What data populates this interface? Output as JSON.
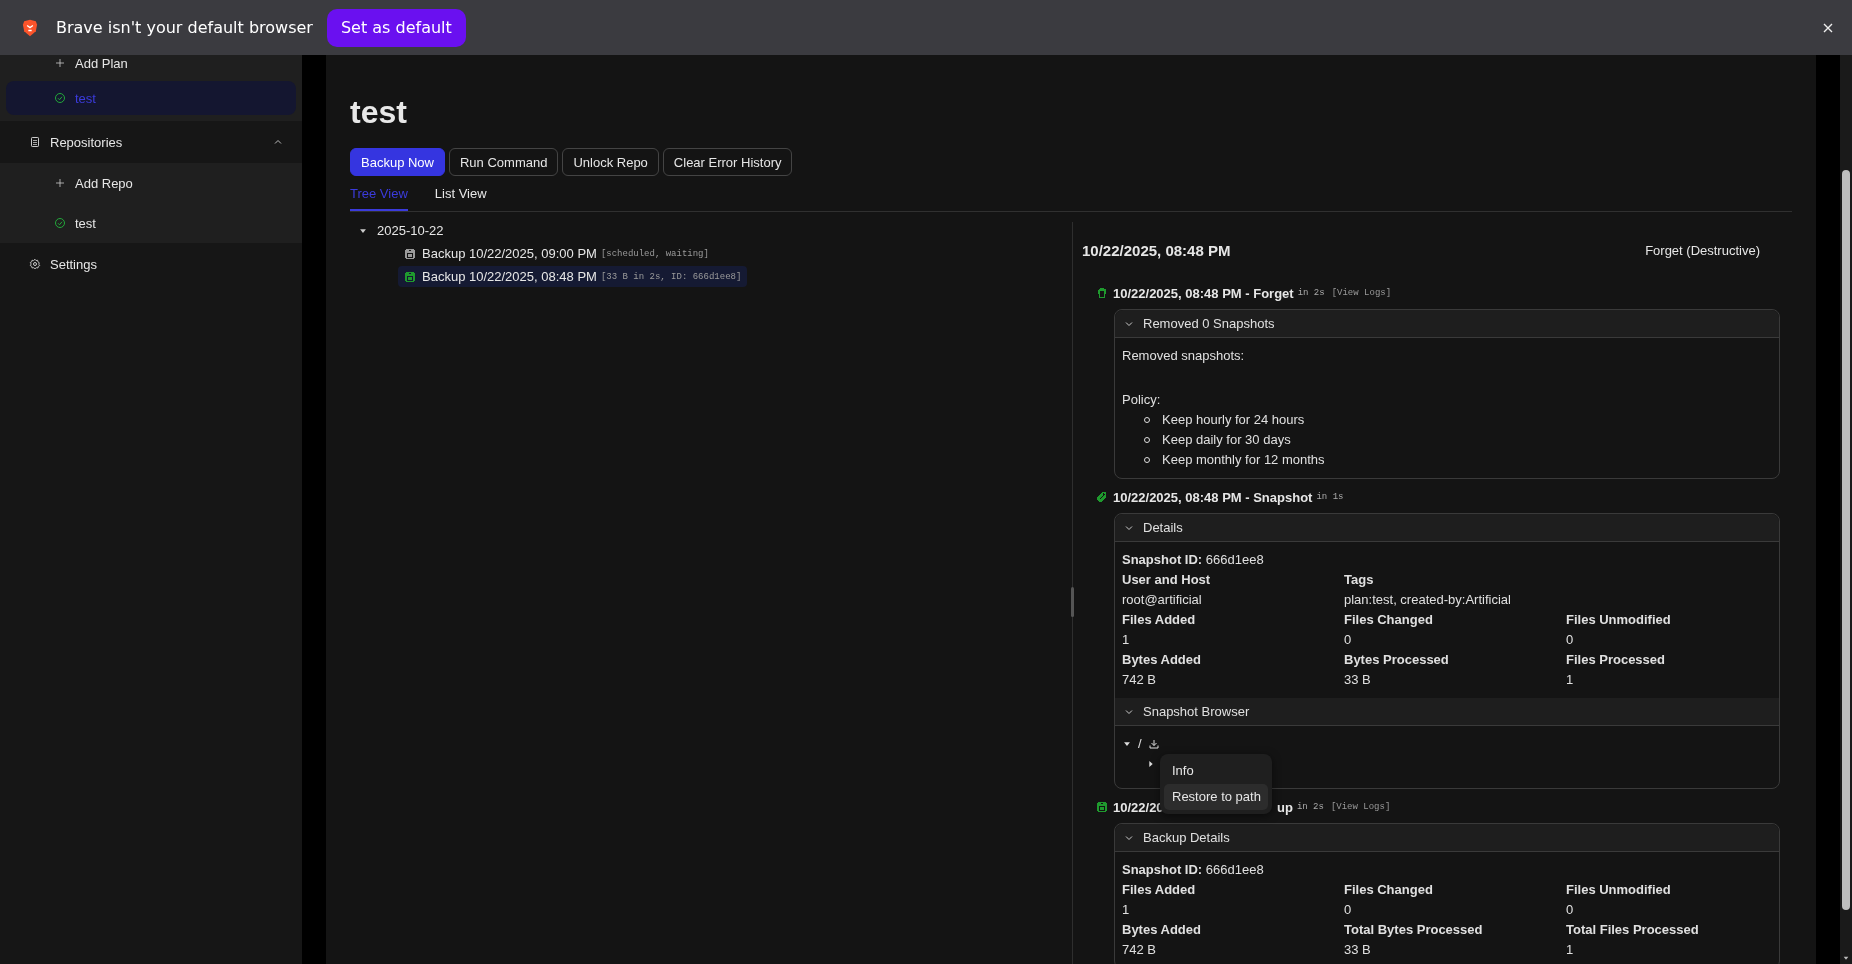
{
  "infobar": {
    "message": "Brave isn't your default browser",
    "button": "Set as default"
  },
  "sidebar": {
    "items": [
      {
        "kind": "action",
        "label": "Add Plan",
        "selected": false
      },
      {
        "kind": "plan",
        "label": "test",
        "selected": true
      },
      {
        "kind": "group",
        "label": "Repositories",
        "expanded": true,
        "children": [
          {
            "kind": "action",
            "label": "Add Repo",
            "selected": false
          },
          {
            "kind": "repo",
            "label": "test",
            "selected": false
          }
        ]
      },
      {
        "kind": "settings",
        "label": "Settings",
        "selected": false
      }
    ]
  },
  "plan": {
    "title": "test",
    "buttons": [
      {
        "label": "Backup Now",
        "kind": "primary"
      },
      {
        "label": "Run Command",
        "kind": "secondary"
      },
      {
        "label": "Unlock Repo",
        "kind": "secondary"
      },
      {
        "label": "Clear Error History",
        "kind": "secondary"
      }
    ],
    "tabs": [
      {
        "label": "Tree View",
        "selected": true
      },
      {
        "label": "List View",
        "selected": false
      }
    ],
    "tree": [
      {
        "label": "2025-10-22",
        "expanded": true,
        "children": [
          {
            "label": "Backup 10/22/2025, 09:00 PM",
            "meta": "[scheduled, waiting]",
            "color": "#9a9a9a",
            "selected": false
          },
          {
            "label": "Backup 10/22/2025, 08:48 PM",
            "meta": "[33 B in 2s, ID: 666d1ee8]",
            "color": "#1f9a2e",
            "selected": true
          }
        ]
      }
    ]
  },
  "detail": {
    "title": "10/22/2025, 08:48 PM",
    "action_button": "Forget (Destructive)",
    "operations": [
      {
        "kind": "forget",
        "color": "#1f9a2e",
        "title_parts": [
          "10/22/2025, 08:48 PM - Forget"
        ],
        "duration": "in 2s",
        "logs_link": "[View Logs]",
        "sections": [
          {
            "kind": "forget_result",
            "title": "Removed 0 Snapshots",
            "expanded": true,
            "removed_label": "Removed snapshots:",
            "policy_label": "Policy:",
            "policy": [
              "Keep hourly for 24 hours",
              "Keep daily for 30 days",
              "Keep monthly for 12 months"
            ]
          }
        ]
      },
      {
        "kind": "snapshot",
        "color": "#1f9a2e",
        "title_parts": [
          "10/22/2025, 08:48 PM - Snapshot"
        ],
        "duration": "in 1s",
        "sections": [
          {
            "kind": "details",
            "title": "Details",
            "expanded": true,
            "snapshot_id_label": "Snapshot ID:",
            "snapshot_id": "666d1ee8",
            "rows": [
              [
                {
                  "label": "User and Host",
                  "value": "root@artificial"
                },
                {
                  "label": "Tags",
                  "value": "plan:test, created-by:Artificial"
                }
              ],
              [
                {
                  "label": "Files Added",
                  "value": "1"
                },
                {
                  "label": "Files Changed",
                  "value": "0"
                },
                {
                  "label": "Files Unmodified",
                  "value": "0"
                }
              ],
              [
                {
                  "label": "Bytes Added",
                  "value": "742 B"
                },
                {
                  "label": "Bytes Processed",
                  "value": "33 B"
                },
                {
                  "label": "Files Processed",
                  "value": "1"
                }
              ]
            ]
          },
          {
            "kind": "browser",
            "title": "Snapshot Browser",
            "expanded": true,
            "tree": [
              {
                "label": "/",
                "expanded": true,
                "children": [
                  {
                    "expanded": false,
                    "context_menu": {
                      "items": [
                        {
                          "label": "Info",
                          "selected": false
                        },
                        {
                          "label": "Restore to path",
                          "selected": true
                        }
                      ]
                    }
                  }
                ]
              }
            ]
          }
        ]
      },
      {
        "kind": "backup",
        "color": "#1f9a2e",
        "title_parts": [
          "10/22/20",
          "up"
        ],
        "duration": "in 2s",
        "logs_link": "[View Logs]",
        "sections": [
          {
            "kind": "details",
            "title": "Backup Details",
            "expanded": true,
            "snapshot_id_label": "Snapshot ID:",
            "snapshot_id": "666d1ee8",
            "rows": [
              [
                {
                  "label": "Files Added",
                  "value": "1"
                },
                {
                  "label": "Files Changed",
                  "value": "0"
                },
                {
                  "label": "Files Unmodified",
                  "value": "0"
                }
              ],
              [
                {
                  "label": "Bytes Added",
                  "value": "742 B"
                },
                {
                  "label": "Total Bytes Processed",
                  "value": "33 B"
                },
                {
                  "label": "Total Files Processed",
                  "value": "1"
                }
              ]
            ]
          }
        ]
      }
    ]
  }
}
